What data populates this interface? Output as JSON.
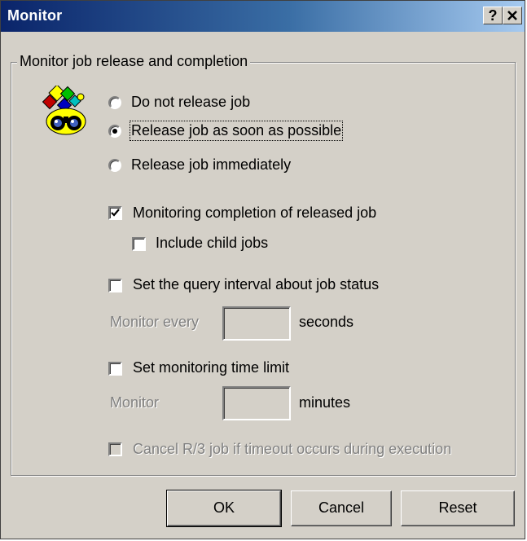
{
  "window": {
    "title": "Monitor",
    "help_button": "?",
    "close_button": "✕"
  },
  "group": {
    "label": "Monitor job release and completion",
    "icon": "job-monitor-binoculars-icon"
  },
  "release_options": [
    {
      "label": "Do not release job",
      "selected": false
    },
    {
      "label": "Release job as soon as possible",
      "selected": true
    },
    {
      "label": "Release job immediately",
      "selected": false
    }
  ],
  "monitoring": {
    "completion_label": "Monitoring completion of released job",
    "completion_checked": true,
    "child_jobs_label": "Include child jobs",
    "child_jobs_checked": false,
    "query_interval_label": "Set the query interval about job status",
    "query_interval_checked": false,
    "monitor_every_label": "Monitor every",
    "monitor_every_value": "",
    "seconds_label": "seconds",
    "time_limit_label": "Set monitoring time limit",
    "time_limit_checked": false,
    "monitor_label": "Monitor",
    "monitor_value": "",
    "minutes_label": "minutes",
    "cancel_label": "Cancel R/3 job if timeout occurs during execution",
    "cancel_checked": false
  },
  "buttons": {
    "ok": "OK",
    "cancel": "Cancel",
    "reset": "Reset"
  }
}
